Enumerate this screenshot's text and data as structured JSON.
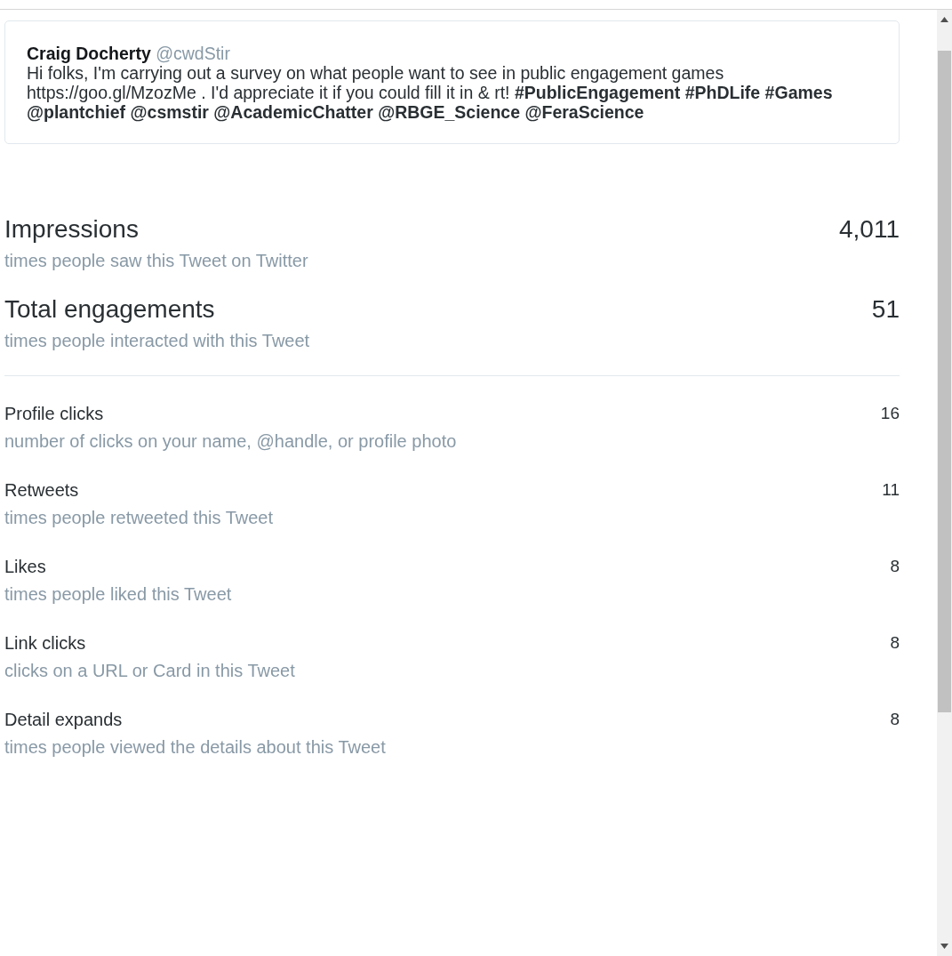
{
  "tweet": {
    "author": "Craig Docherty",
    "handle": "@cwdStir",
    "text": "Hi folks, I'm carrying out a survey on what people want to see in public engagement games https://goo.gl/MzozMe . I'd appreciate it if you could fill it in & rt! **#PublicEngagement #PhDLife #Games @plantchief @csmstir @AcademicChatter @RBGE_Science @FeraScience**"
  },
  "summary_metrics": [
    {
      "label": "Impressions",
      "description": "times people saw this Tweet on Twitter",
      "value": "4,011"
    },
    {
      "label": "Total engagements",
      "description": "times people interacted with this Tweet",
      "value": "51"
    }
  ],
  "detail_metrics": [
    {
      "label": "Profile clicks",
      "description": "number of clicks on your name, @handle, or profile photo",
      "value": "16"
    },
    {
      "label": "Retweets",
      "description": "times people retweeted this Tweet",
      "value": "11"
    },
    {
      "label": "Likes",
      "description": "times people liked this Tweet",
      "value": "8"
    },
    {
      "label": "Link clicks",
      "description": "clicks on a URL or Card in this Tweet",
      "value": "8"
    },
    {
      "label": "Detail expands",
      "description": "times people viewed the details about this Tweet",
      "value": "8"
    }
  ]
}
